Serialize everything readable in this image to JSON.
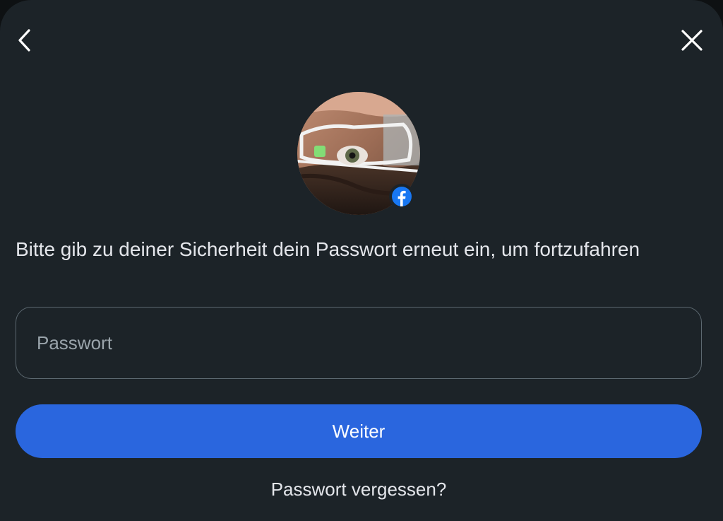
{
  "header": {
    "back_icon": "chevron-left-icon",
    "close_icon": "close-icon"
  },
  "profile": {
    "badge_icon": "facebook-icon",
    "badge_color": "#1877f2"
  },
  "prompt": {
    "text": "Bitte gib zu deiner Sicherheit dein Passwort erneut ein, um fortzufahren"
  },
  "password": {
    "placeholder": "Passwort",
    "value": ""
  },
  "actions": {
    "continue_label": "Weiter",
    "forgot_label": "Passwort vergessen?"
  },
  "colors": {
    "background": "#1c2328",
    "accent": "#2a66de",
    "text": "#e4e6eb"
  }
}
